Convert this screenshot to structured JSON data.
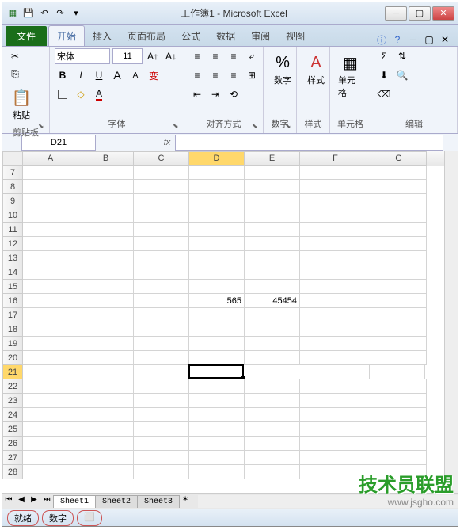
{
  "title": "工作簿1 - Microsoft Excel",
  "tabs": {
    "file": "文件",
    "home": "开始",
    "insert": "插入",
    "layout": "页面布局",
    "formulas": "公式",
    "data": "数据",
    "review": "审阅",
    "view": "视图"
  },
  "groups": {
    "clipboard": {
      "label": "剪贴板",
      "paste": "粘贴"
    },
    "font": {
      "label": "字体",
      "name": "宋体",
      "size": "11"
    },
    "align": {
      "label": "对齐方式"
    },
    "number": {
      "label": "数字",
      "btn": "数字"
    },
    "styles": {
      "label": "样式",
      "btn": "样式"
    },
    "cells": {
      "label": "单元格",
      "btn": "单元格"
    },
    "editing": {
      "label": "编辑"
    }
  },
  "namebox": "D21",
  "columns": [
    "A",
    "B",
    "C",
    "D",
    "E",
    "F",
    "G"
  ],
  "rows": [
    7,
    8,
    9,
    10,
    11,
    12,
    13,
    14,
    15,
    16,
    17,
    18,
    19,
    20,
    21,
    22,
    23,
    24,
    25,
    26,
    27,
    28
  ],
  "selected_cell": "D21",
  "cell_data": {
    "D16": "565",
    "E16": "45454"
  },
  "sheets": [
    "Sheet1",
    "Sheet2",
    "Sheet3"
  ],
  "status": {
    "ready": "就绪",
    "num": "数字"
  },
  "watermark": {
    "text": "技术员联盟",
    "url": "www.jsgho.com"
  }
}
